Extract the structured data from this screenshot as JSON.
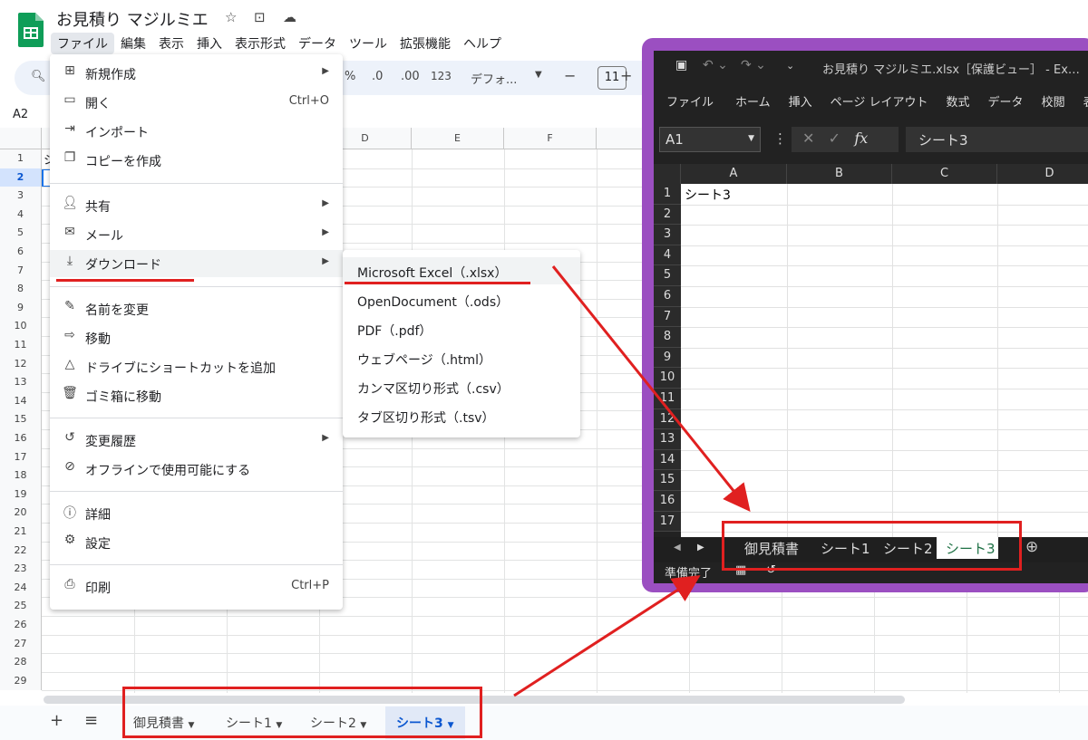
{
  "app": {
    "title": "お見積り マジルミエ",
    "menu": [
      "ファイル",
      "編集",
      "表示",
      "挿入",
      "表示形式",
      "データ",
      "ツール",
      "拡張機能",
      "ヘルプ"
    ]
  },
  "toolbar": {
    "items": [
      "%",
      ".0",
      ".00",
      "123",
      "デフォ...",
      "−",
      "+"
    ],
    "font_size": "11"
  },
  "cell_ref": "A2",
  "columns": [
    "D",
    "E",
    "F"
  ],
  "rows": [
    "1",
    "2",
    "3",
    "4",
    "5",
    "6",
    "7",
    "8",
    "9",
    "10",
    "11",
    "12",
    "13",
    "14",
    "15",
    "16",
    "17",
    "18",
    "19",
    "20",
    "21",
    "22",
    "23",
    "24",
    "25",
    "26",
    "27",
    "28",
    "29"
  ],
  "cell_a1_partial": "シ",
  "file_menu": {
    "items": [
      {
        "icon": "plus-square-icon",
        "label": "新規作成",
        "arrow": true
      },
      {
        "icon": "folder-icon",
        "label": "開く",
        "shortcut": "Ctrl+O"
      },
      {
        "icon": "import-icon",
        "label": "インポート"
      },
      {
        "icon": "copy-icon",
        "label": "コピーを作成"
      },
      {
        "icon": "person-add-icon",
        "label": "共有",
        "arrow": true
      },
      {
        "icon": "mail-icon",
        "label": "メール",
        "arrow": true
      },
      {
        "icon": "download-icon",
        "label": "ダウンロード",
        "arrow": true
      },
      {
        "icon": "rename-icon",
        "label": "名前を変更"
      },
      {
        "icon": "move-icon",
        "label": "移動"
      },
      {
        "icon": "drive-shortcut-icon",
        "label": "ドライブにショートカットを追加"
      },
      {
        "icon": "trash-icon",
        "label": "ゴミ箱に移動"
      },
      {
        "icon": "history-icon",
        "label": "変更履歴",
        "arrow": true
      },
      {
        "icon": "offline-icon",
        "label": "オフラインで使用可能にする"
      },
      {
        "icon": "info-icon",
        "label": "詳細"
      },
      {
        "icon": "gear-icon",
        "label": "設定"
      },
      {
        "icon": "print-icon",
        "label": "印刷",
        "shortcut": "Ctrl+P"
      }
    ]
  },
  "download_submenu": [
    "Microsoft Excel（.xlsx）",
    "OpenDocument（.ods）",
    "PDF（.pdf）",
    "ウェブページ（.html）",
    "カンマ区切り形式（.csv）",
    "タブ区切り形式（.tsv）"
  ],
  "sheet_tabs": [
    "御見積書",
    "シート1",
    "シート2",
    "シート3"
  ],
  "excel": {
    "title": "お見積り マジルミエ.xlsx［保護ビュー］ - Ex…",
    "ribbon": [
      "ファイル",
      "ホーム",
      "挿入",
      "ページ レイアウト",
      "数式",
      "データ",
      "校閲",
      "表示"
    ],
    "name_box": "A1",
    "formula_value": "シート3",
    "columns": [
      "A",
      "B",
      "C",
      "D"
    ],
    "rows": [
      "1",
      "2",
      "3",
      "4",
      "5",
      "6",
      "7",
      "8",
      "9",
      "10",
      "11",
      "12",
      "13",
      "14",
      "15",
      "16",
      "17"
    ],
    "cell_a1": "シート3",
    "sheet_tabs": [
      "御見積書",
      "シート1",
      "シート2",
      "シート3"
    ],
    "status": "準備完了"
  },
  "colors": {
    "annotation_red": "#e02020",
    "excel_frame": "#9b4fc1",
    "sheets_active_tab": "#0b57d0",
    "excel_active_tab": "#1e7145"
  }
}
